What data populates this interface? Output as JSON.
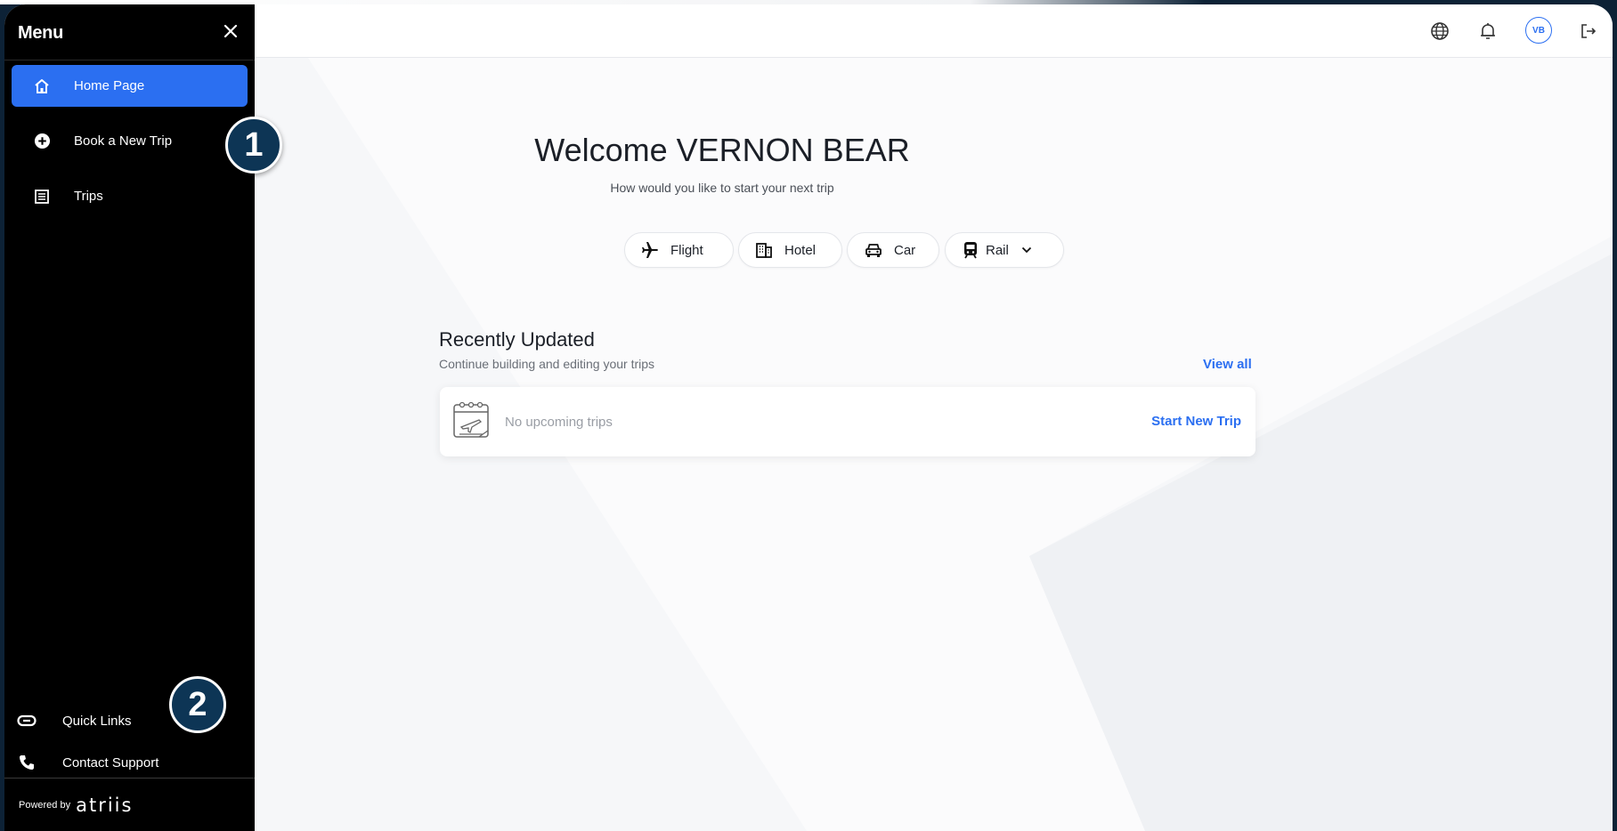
{
  "sidebar": {
    "title": "Menu",
    "items": [
      {
        "label": "Home Page",
        "icon": "home-icon",
        "active": true
      },
      {
        "label": "Book a New Trip",
        "icon": "plus-circle-icon",
        "active": false
      },
      {
        "label": "Trips",
        "icon": "list-icon",
        "active": false
      }
    ],
    "bottom_items": [
      {
        "label": "Quick Links",
        "icon": "link-icon"
      },
      {
        "label": "Contact Support",
        "icon": "phone-icon"
      }
    ],
    "powered_by": "Powered by",
    "brand": "atriis"
  },
  "callouts": [
    "1",
    "2"
  ],
  "header": {
    "avatar_initials": "VB",
    "icons": [
      "globe-icon",
      "bell-icon",
      "avatar",
      "logout-icon"
    ]
  },
  "main": {
    "welcome": "Welcome VERNON BEAR",
    "subtitle": "How would you like to start your next trip",
    "trip_types": [
      {
        "label": "Flight",
        "icon": "plane-icon"
      },
      {
        "label": "Hotel",
        "icon": "building-icon"
      },
      {
        "label": "Car",
        "icon": "car-icon"
      },
      {
        "label": "Rail",
        "icon": "train-icon"
      }
    ],
    "recent": {
      "title": "Recently Updated",
      "subtitle": "Continue building and editing your trips",
      "view_all": "View all",
      "empty_text": "No upcoming trips",
      "start_new": "Start New Trip"
    }
  },
  "colors": {
    "accent": "#2b6ff1",
    "sidebar_bg": "#000000",
    "callout_bg": "#0d3555"
  }
}
